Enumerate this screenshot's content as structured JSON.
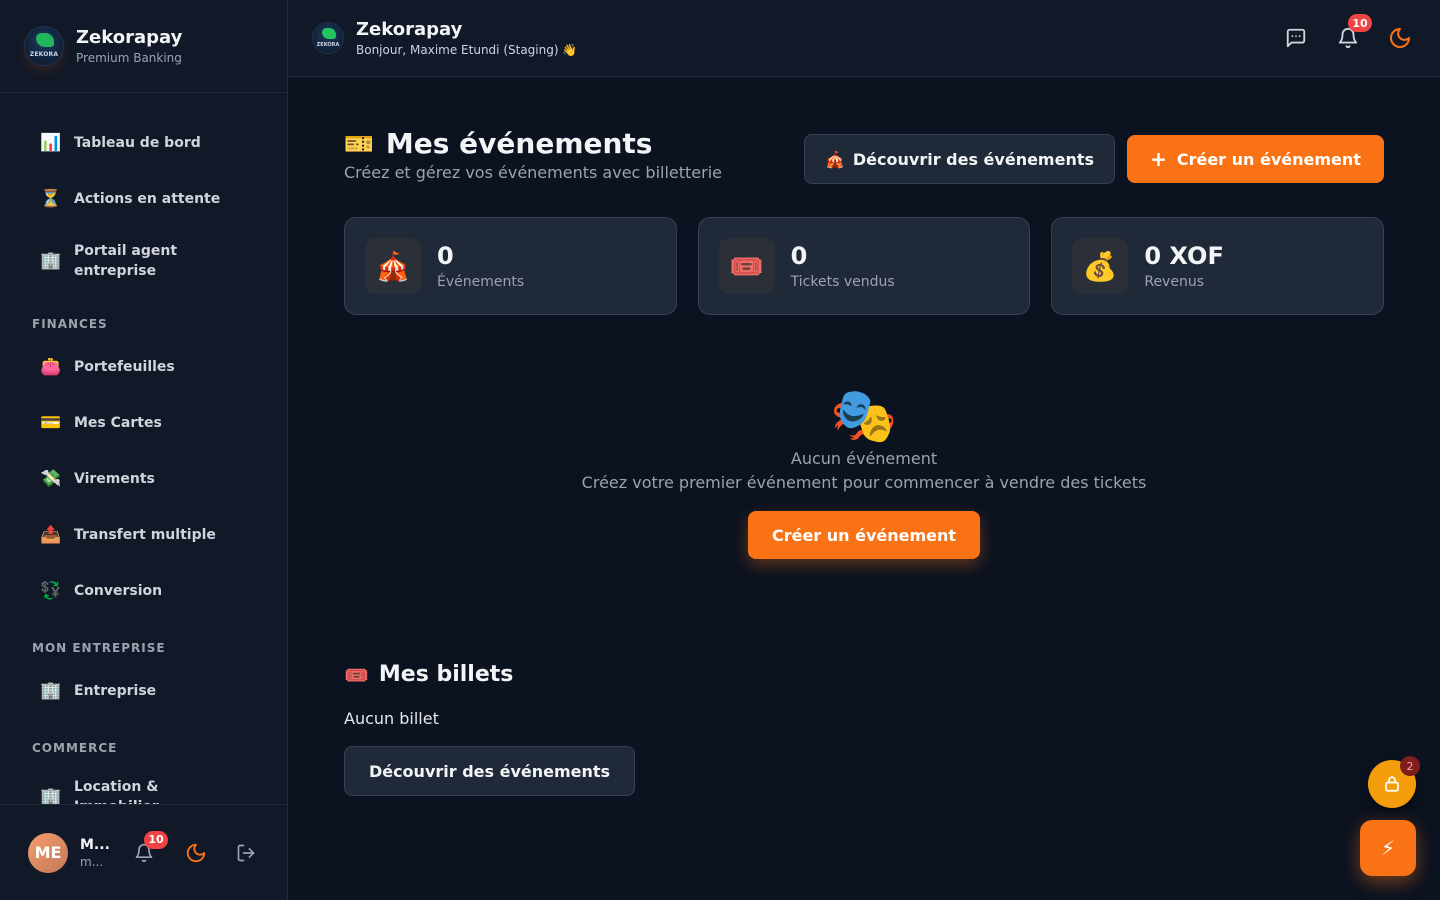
{
  "brand": {
    "name": "Zekorapay",
    "subtitle": "Premium Banking",
    "logo_text": "ZEKORA"
  },
  "sidebar": {
    "items": [
      {
        "icon": "📊",
        "label": "Tableau de bord"
      },
      {
        "icon": "⏳",
        "label": "Actions en attente"
      },
      {
        "icon": "🏢",
        "label": "Portail agent entreprise"
      }
    ],
    "sections": [
      {
        "title": "FINANCES",
        "items": [
          {
            "icon": "👛",
            "label": "Portefeuilles"
          },
          {
            "icon": "💳",
            "label": "Mes Cartes"
          },
          {
            "icon": "💸",
            "label": "Virements"
          },
          {
            "icon": "📤",
            "label": "Transfert multiple"
          },
          {
            "icon": "💱",
            "label": "Conversion"
          }
        ]
      },
      {
        "title": "MON ENTREPRISE",
        "items": [
          {
            "icon": "🏢",
            "label": "Entreprise"
          }
        ]
      },
      {
        "title": "COMMERCE",
        "items": [
          {
            "icon": "🏢",
            "label": "Location & Immobilier"
          }
        ]
      }
    ]
  },
  "user": {
    "initials": "ME",
    "name": "M...",
    "email": "m...",
    "notifications": "10"
  },
  "header": {
    "title": "Zekorapay",
    "greeting": "Bonjour, Maxime Etundi (Staging) 👋",
    "notifications": "10"
  },
  "page": {
    "icon": "🎫",
    "title": "Mes événements",
    "subtitle": "Créez et gérez vos événements avec billetterie",
    "discover_icon": "🎪",
    "discover_label": "Découvrir des événements",
    "create_icon": "+",
    "create_label": "Créer un événement"
  },
  "stats": [
    {
      "icon": "🎪",
      "value": "0",
      "label": "Événements"
    },
    {
      "icon": "🎟️",
      "value": "0",
      "label": "Tickets vendus"
    },
    {
      "icon": "💰",
      "value": "0 XOF",
      "label": "Revenus"
    }
  ],
  "empty": {
    "icon": "🎭",
    "title": "Aucun événement",
    "description": "Créez votre premier événement pour commencer à vendre des tickets",
    "button": "Créer un événement"
  },
  "tickets": {
    "icon": "🎟️",
    "title": "Mes billets",
    "empty": "Aucun billet",
    "button": "Découvrir des événements"
  },
  "floating": {
    "lock_count": "2",
    "bolt": "⚡"
  },
  "colors": {
    "accent": "#f97316",
    "background": "#0b1220",
    "sidebar": "#111827",
    "badge": "#ef4444"
  }
}
